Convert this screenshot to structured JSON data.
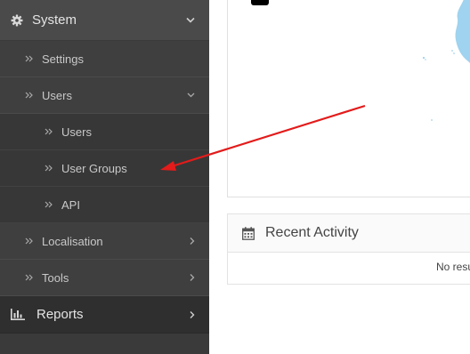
{
  "sidebar": {
    "system": {
      "label": "System",
      "icon": "gear-icon",
      "chevron": "chevron-down-icon"
    },
    "settings": {
      "label": "Settings"
    },
    "users": {
      "label": "Users",
      "chevron": "chevron-down-icon"
    },
    "users_sub": [
      {
        "label": "Users"
      },
      {
        "label": "User Groups"
      },
      {
        "label": "API"
      }
    ],
    "localisation": {
      "label": "Localisation",
      "chevron": "chevron-right-icon"
    },
    "tools": {
      "label": "Tools",
      "chevron": "chevron-right-icon"
    },
    "reports": {
      "label": "Reports",
      "icon": "bar-chart-icon",
      "chevron": "chevron-right-icon"
    }
  },
  "main": {
    "recent_activity": {
      "title": "Recent Activity",
      "icon": "calendar-icon",
      "empty_text": "No resu"
    }
  },
  "annotation": {
    "color": "#e31b1b",
    "points_to": "User Groups"
  },
  "colors": {
    "sidebar_bg": "#3f3f3f",
    "sidebar_text": "#c9c9c9",
    "map_water": "#9fd3ef"
  }
}
